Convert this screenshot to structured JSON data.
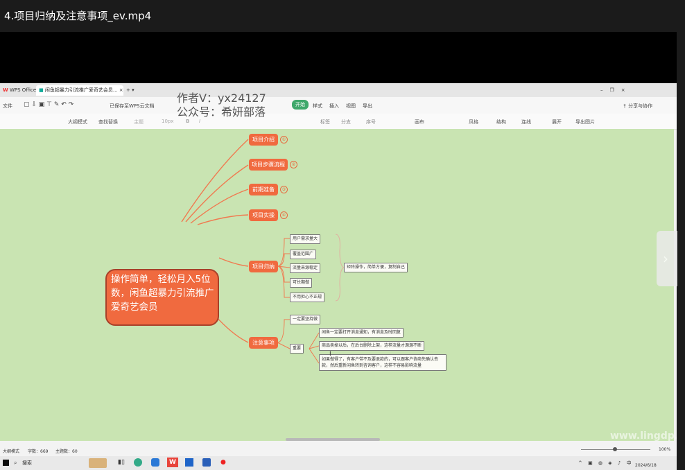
{
  "window": {
    "title": "4.项目归纳及注意事项_ev.mp4"
  },
  "wps": {
    "tabs": [
      {
        "label": "WPS Office"
      },
      {
        "label": "闲鱼超暴力引流推广爱奇艺会员..."
      }
    ],
    "menu": {
      "file": "文件",
      "cloud_save": "已保存至WPS云文档",
      "tabs": [
        "开始",
        "样式",
        "插入",
        "视图",
        "导出"
      ],
      "share": "分享与协作"
    },
    "toolbar": [
      "大纲模式",
      "查找替换",
      "主题",
      "10px",
      "B",
      "I",
      "标签",
      "分支",
      "序号",
      "画布",
      "风格",
      "结构",
      "连线",
      "展开",
      "导出图片"
    ]
  },
  "overlay": {
    "author": "作者V：yx24127",
    "account": "公众号：希妍部落"
  },
  "mindmap": {
    "central": "操作简单，轻松月入5位数，闲鱼超暴力引流推广爱奇艺会员",
    "branches": [
      {
        "label": "项目介绍",
        "badge": "①"
      },
      {
        "label": "项目步骤流程",
        "badge": "②"
      },
      {
        "label": "前期准备",
        "badge": "③"
      },
      {
        "label": "项目实操",
        "badge": "④"
      },
      {
        "label": "项目归纳"
      },
      {
        "label": "注意事项"
      }
    ],
    "summary_items": [
      "用户需求量大",
      "覆盖范围广",
      "流量来源稳定",
      "可长期做",
      "不用担心不正规"
    ],
    "summary_note": "矩阵操作，简单方便，复制自己",
    "notes": {
      "persist": "一定要坚持做",
      "important": "重要",
      "items": [
        "闲鱼一定要打开消息通知，有消息及时回复",
        "商品卖掉以后，在后台删除上架，这样流量才源源不断",
        "如果做得了，有客户带不及要退款的，可以跟客户协商先确认去款，然后重新闲鱼转到咨询客户，这样不容易影响流量"
      ]
    }
  },
  "statusbar": {
    "mode": "大纲模式",
    "words": "字数：669",
    "count": "主题数：60",
    "zoom": "100%"
  },
  "taskbar": {
    "search": "搜索",
    "date": "2024/6/18"
  },
  "site_watermark": "www.lingdp.com"
}
